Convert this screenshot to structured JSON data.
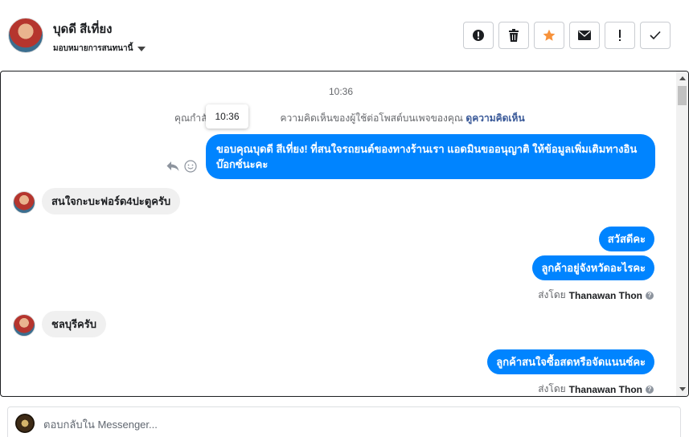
{
  "header": {
    "contact_name": "บุดดี สีเที่ยง",
    "assign_label": "มอบหมายการสนทนานี้",
    "toolbar": {
      "buttons": [
        {
          "icon": "alert-circle-icon",
          "label": "Mark as spam"
        },
        {
          "icon": "trash-icon",
          "label": "Delete"
        },
        {
          "icon": "star-icon",
          "label": "Star",
          "color": "#f7923b"
        },
        {
          "icon": "envelope-icon",
          "label": "Mark as unread"
        },
        {
          "icon": "exclamation-icon",
          "label": "Follow up"
        },
        {
          "icon": "check-icon",
          "label": "Mark as done"
        }
      ]
    }
  },
  "conversation": {
    "timestamp": "10:36",
    "system_note": {
      "prefix": "คุณกำลั",
      "middle": "ความคิดเห็นของผู้ใช้ต่อโพสต์บนเพจของคุณ",
      "link": "ดูความคิดเห็น"
    },
    "tooltip": "10:36",
    "messages": [
      {
        "from": "page",
        "text": "ขอบคุณบุดดี สีเที่ยง! ที่สนใจรถยนต์ของทางร้านเรา แอดมินขออนุญาติ ให้ข้อมูลเพิ่มเติมทางอินบ๊อกซ์นะคะ"
      },
      {
        "from": "customer",
        "text": "สนใจกะบะฟอร์ด4ปะตูครับ"
      },
      {
        "from": "page",
        "text": "สวัสดีคะ"
      },
      {
        "from": "page",
        "text": "ลูกค้าอยู่จังหวัดอะไรคะ"
      },
      {
        "from": "customer",
        "text": "ชลบุรีครับ"
      },
      {
        "from": "page",
        "text": "ลูกค้าสนใจซื้อสดหรือจัดแนนซ์คะ"
      }
    ],
    "sent_by": [
      {
        "label": "ส่งโดย",
        "agent": "Thanawan Thon"
      },
      {
        "label": "ส่งโดย",
        "agent": "Thanawan Thon"
      }
    ]
  },
  "composer": {
    "placeholder": "ตอบกลับใน Messenger..."
  },
  "colors": {
    "accent": "#0084ff",
    "incoming_bubble": "#f0f0f0",
    "star": "#f7923b",
    "link": "#385898"
  }
}
